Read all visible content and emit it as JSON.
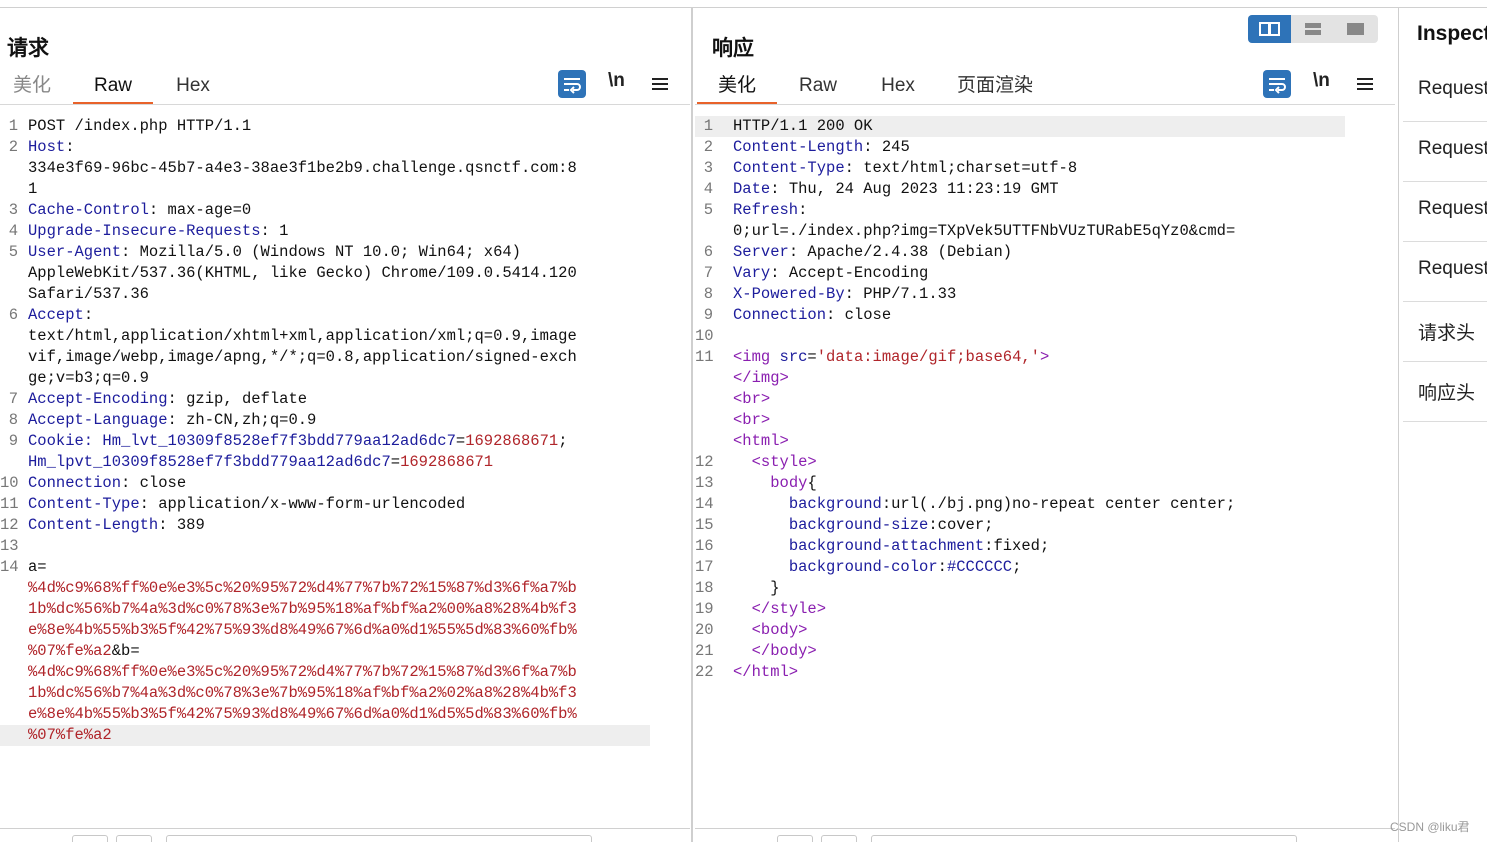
{
  "request": {
    "title": "请求",
    "tabs": [
      "美化",
      "Raw",
      "Hex"
    ],
    "active_tab": "Raw",
    "newline_label": "\\n",
    "lines": [
      {
        "n": "1",
        "parts": [
          [
            "v",
            "POST /index.php HTTP/1.1"
          ]
        ]
      },
      {
        "n": "2",
        "parts": [
          [
            "k",
            "Host"
          ],
          [
            "v",
            ":"
          ]
        ]
      },
      {
        "n": "",
        "parts": [
          [
            "v",
            "334e3f69-96bc-45b7-a4e3-38ae3f1be2b9.challenge.qsnctf.com:8"
          ]
        ]
      },
      {
        "n": "",
        "parts": [
          [
            "v",
            "1"
          ]
        ]
      },
      {
        "n": "3",
        "parts": [
          [
            "k",
            "Cache-Control"
          ],
          [
            "v",
            ": max-age=0"
          ]
        ]
      },
      {
        "n": "4",
        "parts": [
          [
            "k",
            "Upgrade-Insecure-Requests"
          ],
          [
            "v",
            ": 1"
          ]
        ]
      },
      {
        "n": "5",
        "parts": [
          [
            "k",
            "User-Agent"
          ],
          [
            "v",
            ": Mozilla/5.0 (Windows NT 10.0; Win64; x64)"
          ]
        ]
      },
      {
        "n": "",
        "parts": [
          [
            "v",
            "AppleWebKit/537.36(KHTML, like Gecko) Chrome/109.0.5414.120"
          ]
        ]
      },
      {
        "n": "",
        "parts": [
          [
            "v",
            "Safari/537.36"
          ]
        ]
      },
      {
        "n": "6",
        "parts": [
          [
            "k",
            "Accept"
          ],
          [
            "v",
            ":"
          ]
        ]
      },
      {
        "n": "",
        "parts": [
          [
            "v",
            "text/html,application/xhtml+xml,application/xml;q=0.9,image"
          ]
        ]
      },
      {
        "n": "",
        "parts": [
          [
            "v",
            "vif,image/webp,image/apng,*/*;q=0.8,application/signed-exch"
          ]
        ]
      },
      {
        "n": "",
        "parts": [
          [
            "v",
            "ge;v=b3;q=0.9"
          ]
        ]
      },
      {
        "n": "7",
        "parts": [
          [
            "k",
            "Accept-Encoding"
          ],
          [
            "v",
            ": gzip, deflate"
          ]
        ]
      },
      {
        "n": "8",
        "parts": [
          [
            "k",
            "Accept-Language"
          ],
          [
            "v",
            ": zh-CN,zh;q=0.9"
          ]
        ]
      },
      {
        "n": "9",
        "parts": [
          [
            "k",
            "Cookie: Hm_lvt_10309f8528ef7f3bdd779aa12ad6dc7"
          ],
          [
            "v",
            "="
          ],
          [
            "red",
            "1692868671"
          ],
          [
            "v",
            ";"
          ]
        ]
      },
      {
        "n": "",
        "parts": [
          [
            "k",
            "Hm_lpvt_10309f8528ef7f3bdd779aa12ad6dc7"
          ],
          [
            "v",
            "="
          ],
          [
            "red",
            "1692868671"
          ]
        ]
      },
      {
        "n": "10",
        "parts": [
          [
            "k",
            "Connection"
          ],
          [
            "v",
            ": close"
          ]
        ]
      },
      {
        "n": "11",
        "parts": [
          [
            "k",
            "Content-Type"
          ],
          [
            "v",
            ": application/x-www-form-urlencoded"
          ]
        ]
      },
      {
        "n": "12",
        "parts": [
          [
            "k",
            "Content-Length"
          ],
          [
            "v",
            ": 389"
          ]
        ]
      },
      {
        "n": "13",
        "parts": []
      },
      {
        "n": "14",
        "parts": [
          [
            "v",
            "a="
          ]
        ]
      },
      {
        "n": "",
        "parts": [
          [
            "red",
            "%4d%c9%68%ff%0e%e3%5c%20%95%72%d4%77%7b%72%15%87%d3%6f%a7%b"
          ]
        ]
      },
      {
        "n": "",
        "parts": [
          [
            "red",
            "1b%dc%56%b7%4a%3d%c0%78%3e%7b%95%18%af%bf%a2%00%a8%28%4b%f3"
          ]
        ]
      },
      {
        "n": "",
        "parts": [
          [
            "red",
            "e%8e%4b%55%b3%5f%42%75%93%d8%49%67%6d%a0%d1%55%5d%83%60%fb%"
          ]
        ]
      },
      {
        "n": "",
        "parts": [
          [
            "red",
            "%07%fe%a2"
          ],
          [
            "v",
            "&b="
          ]
        ]
      },
      {
        "n": "",
        "parts": [
          [
            "red",
            "%4d%c9%68%ff%0e%e3%5c%20%95%72%d4%77%7b%72%15%87%d3%6f%a7%b"
          ]
        ]
      },
      {
        "n": "",
        "parts": [
          [
            "red",
            "1b%dc%56%b7%4a%3d%c0%78%3e%7b%95%18%af%bf%a2%02%a8%28%4b%f3"
          ]
        ]
      },
      {
        "n": "",
        "parts": [
          [
            "red",
            "e%8e%4b%55%b3%5f%42%75%93%d8%49%67%6d%a0%d1%d5%5d%83%60%fb%"
          ]
        ]
      },
      {
        "n": "",
        "parts": [
          [
            "red",
            "%07%fe%a2"
          ]
        ],
        "highlight": true
      }
    ]
  },
  "response": {
    "title": "响应",
    "tabs": [
      "美化",
      "Raw",
      "Hex",
      "页面渲染"
    ],
    "active_tab": "美化",
    "newline_label": "\\n",
    "lines": [
      {
        "n": "1",
        "parts": [
          [
            "v",
            "HTTP/1.1 200 OK"
          ]
        ],
        "highlight": true
      },
      {
        "n": "2",
        "parts": [
          [
            "k",
            "Content-Length"
          ],
          [
            "v",
            ": 245"
          ]
        ]
      },
      {
        "n": "3",
        "parts": [
          [
            "k",
            "Content-Type"
          ],
          [
            "v",
            ": text/html;charset=utf-8"
          ]
        ]
      },
      {
        "n": "4",
        "parts": [
          [
            "k",
            "Date"
          ],
          [
            "v",
            ": Thu, 24 Aug 2023 11:23:19 GMT"
          ]
        ]
      },
      {
        "n": "5",
        "parts": [
          [
            "k",
            "Refresh"
          ],
          [
            "v",
            ":"
          ]
        ]
      },
      {
        "n": "",
        "parts": [
          [
            "v",
            "0;url=./index.php?img=TXpVek5UTTFNbVUzTURabE5qYz0&cmd="
          ]
        ]
      },
      {
        "n": "6",
        "parts": [
          [
            "k",
            "Server"
          ],
          [
            "v",
            ": Apache/2.4.38 (Debian)"
          ]
        ]
      },
      {
        "n": "7",
        "parts": [
          [
            "k",
            "Vary"
          ],
          [
            "v",
            ": Accept-Encoding"
          ]
        ]
      },
      {
        "n": "8",
        "parts": [
          [
            "k",
            "X-Powered-By"
          ],
          [
            "v",
            ": PHP/7.1.33"
          ]
        ]
      },
      {
        "n": "9",
        "parts": [
          [
            "k",
            "Connection"
          ],
          [
            "v",
            ": close"
          ]
        ]
      },
      {
        "n": "10",
        "parts": []
      },
      {
        "n": "11",
        "parts": [
          [
            "tag",
            "<img "
          ],
          [
            "attr",
            "src"
          ],
          [
            "v",
            "="
          ],
          [
            "str",
            "'data:image/gif;base64,'"
          ],
          [
            "tag",
            ">"
          ]
        ]
      },
      {
        "n": "",
        "parts": [
          [
            "tag",
            "</img>"
          ]
        ]
      },
      {
        "n": "",
        "parts": [
          [
            "tag",
            "<br>"
          ]
        ]
      },
      {
        "n": "",
        "parts": [
          [
            "tag",
            "<br>"
          ]
        ]
      },
      {
        "n": "",
        "parts": [
          [
            "tag",
            "<html>"
          ]
        ]
      },
      {
        "n": "12",
        "parts": [
          [
            "v",
            "  "
          ],
          [
            "tag",
            "<style>"
          ]
        ]
      },
      {
        "n": "13",
        "parts": [
          [
            "v",
            "    "
          ],
          [
            "tag",
            "body"
          ],
          [
            "v",
            "{"
          ]
        ]
      },
      {
        "n": "14",
        "parts": [
          [
            "v",
            "      "
          ],
          [
            "attr",
            "background"
          ],
          [
            "v",
            ":url(./bj.png)no-repeat center center;"
          ]
        ]
      },
      {
        "n": "15",
        "parts": [
          [
            "v",
            "      "
          ],
          [
            "attr",
            "background-size"
          ],
          [
            "v",
            ":cover;"
          ]
        ]
      },
      {
        "n": "16",
        "parts": [
          [
            "v",
            "      "
          ],
          [
            "attr",
            "background-attachment"
          ],
          [
            "v",
            ":fixed;"
          ]
        ]
      },
      {
        "n": "17",
        "parts": [
          [
            "v",
            "      "
          ],
          [
            "attr",
            "background-color"
          ],
          [
            "v",
            ":"
          ],
          [
            "attr",
            "#CCCCCC"
          ],
          [
            "v",
            ";"
          ]
        ]
      },
      {
        "n": "18",
        "parts": [
          [
            "v",
            "    }"
          ]
        ]
      },
      {
        "n": "19",
        "parts": [
          [
            "v",
            "  "
          ],
          [
            "tag",
            "</style>"
          ]
        ]
      },
      {
        "n": "20",
        "parts": [
          [
            "v",
            "  "
          ],
          [
            "tag",
            "<body>"
          ]
        ]
      },
      {
        "n": "21",
        "parts": [
          [
            "v",
            "  "
          ],
          [
            "tag",
            "</body>"
          ]
        ]
      },
      {
        "n": "22",
        "parts": [
          [
            "tag",
            "</html>"
          ]
        ]
      }
    ]
  },
  "inspector": {
    "title": "Inspector",
    "items": [
      "Request",
      "Request",
      "Request",
      "Request",
      "请求头",
      "响应头"
    ]
  },
  "watermark": "CSDN @liku君",
  "accent_color": "#e8622a",
  "button_color": "#2e73b8"
}
